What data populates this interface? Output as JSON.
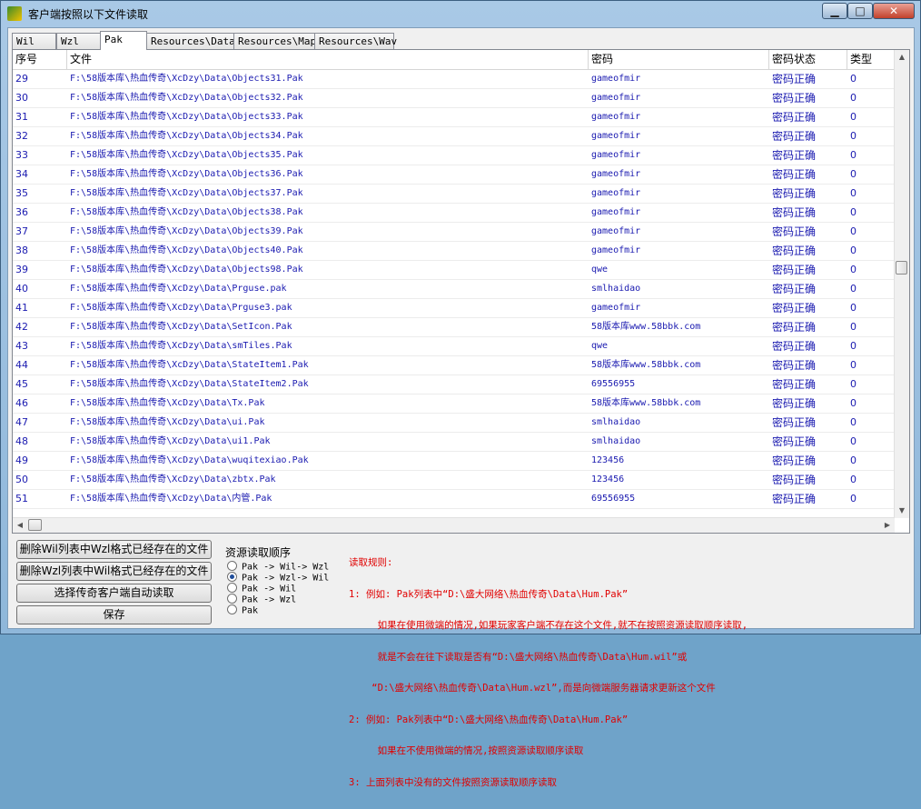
{
  "window": {
    "title": "客户端按照以下文件读取",
    "controls": {
      "minimize": "▁",
      "maximize": "□",
      "close": "✕"
    }
  },
  "tabs": [
    {
      "label": "Wil",
      "active": false
    },
    {
      "label": "Wzl",
      "active": false
    },
    {
      "label": "Pak",
      "active": true
    },
    {
      "label": "Resources\\Data",
      "active": false
    },
    {
      "label": "Resources\\Map",
      "active": false
    },
    {
      "label": "Resources\\Wav",
      "active": false
    }
  ],
  "table": {
    "columns": [
      "序号",
      "文件",
      "密码",
      "密码状态",
      "类型"
    ],
    "rows": [
      {
        "idx": "29",
        "file": "F:\\58版本库\\热血传奇\\XcDzy\\Data\\Objects31.Pak",
        "password": "gameofmir",
        "status": "密码正确",
        "type": "0"
      },
      {
        "idx": "30",
        "file": "F:\\58版本库\\热血传奇\\XcDzy\\Data\\Objects32.Pak",
        "password": "gameofmir",
        "status": "密码正确",
        "type": "0"
      },
      {
        "idx": "31",
        "file": "F:\\58版本库\\热血传奇\\XcDzy\\Data\\Objects33.Pak",
        "password": "gameofmir",
        "status": "密码正确",
        "type": "0"
      },
      {
        "idx": "32",
        "file": "F:\\58版本库\\热血传奇\\XcDzy\\Data\\Objects34.Pak",
        "password": "gameofmir",
        "status": "密码正确",
        "type": "0"
      },
      {
        "idx": "33",
        "file": "F:\\58版本库\\热血传奇\\XcDzy\\Data\\Objects35.Pak",
        "password": "gameofmir",
        "status": "密码正确",
        "type": "0"
      },
      {
        "idx": "34",
        "file": "F:\\58版本库\\热血传奇\\XcDzy\\Data\\Objects36.Pak",
        "password": "gameofmir",
        "status": "密码正确",
        "type": "0"
      },
      {
        "idx": "35",
        "file": "F:\\58版本库\\热血传奇\\XcDzy\\Data\\Objects37.Pak",
        "password": "gameofmir",
        "status": "密码正确",
        "type": "0"
      },
      {
        "idx": "36",
        "file": "F:\\58版本库\\热血传奇\\XcDzy\\Data\\Objects38.Pak",
        "password": "gameofmir",
        "status": "密码正确",
        "type": "0"
      },
      {
        "idx": "37",
        "file": "F:\\58版本库\\热血传奇\\XcDzy\\Data\\Objects39.Pak",
        "password": "gameofmir",
        "status": "密码正确",
        "type": "0"
      },
      {
        "idx": "38",
        "file": "F:\\58版本库\\热血传奇\\XcDzy\\Data\\Objects40.Pak",
        "password": "gameofmir",
        "status": "密码正确",
        "type": "0"
      },
      {
        "idx": "39",
        "file": "F:\\58版本库\\热血传奇\\XcDzy\\Data\\Objects98.Pak",
        "password": "qwe",
        "status": "密码正确",
        "type": "0"
      },
      {
        "idx": "40",
        "file": "F:\\58版本库\\热血传奇\\XcDzy\\Data\\Prguse.pak",
        "password": "smlhaidao",
        "status": "密码正确",
        "type": "0"
      },
      {
        "idx": "41",
        "file": "F:\\58版本库\\热血传奇\\XcDzy\\Data\\Prguse3.pak",
        "password": "gameofmir",
        "status": "密码正确",
        "type": "0"
      },
      {
        "idx": "42",
        "file": "F:\\58版本库\\热血传奇\\XcDzy\\Data\\SetIcon.Pak",
        "password": "58版本库www.58bbk.com",
        "status": "密码正确",
        "type": "0"
      },
      {
        "idx": "43",
        "file": "F:\\58版本库\\热血传奇\\XcDzy\\Data\\smTiles.Pak",
        "password": "qwe",
        "status": "密码正确",
        "type": "0"
      },
      {
        "idx": "44",
        "file": "F:\\58版本库\\热血传奇\\XcDzy\\Data\\StateItem1.Pak",
        "password": "58版本库www.58bbk.com",
        "status": "密码正确",
        "type": "0"
      },
      {
        "idx": "45",
        "file": "F:\\58版本库\\热血传奇\\XcDzy\\Data\\StateItem2.Pak",
        "password": "69556955",
        "status": "密码正确",
        "type": "0"
      },
      {
        "idx": "46",
        "file": "F:\\58版本库\\热血传奇\\XcDzy\\Data\\Tx.Pak",
        "password": "58版本库www.58bbk.com",
        "status": "密码正确",
        "type": "0"
      },
      {
        "idx": "47",
        "file": "F:\\58版本库\\热血传奇\\XcDzy\\Data\\ui.Pak",
        "password": "smlhaidao",
        "status": "密码正确",
        "type": "0"
      },
      {
        "idx": "48",
        "file": "F:\\58版本库\\热血传奇\\XcDzy\\Data\\ui1.Pak",
        "password": "smlhaidao",
        "status": "密码正确",
        "type": "0"
      },
      {
        "idx": "49",
        "file": "F:\\58版本库\\热血传奇\\XcDzy\\Data\\wuqitexiao.Pak",
        "password": "123456",
        "status": "密码正确",
        "type": "0"
      },
      {
        "idx": "50",
        "file": "F:\\58版本库\\热血传奇\\XcDzy\\Data\\zbtx.Pak",
        "password": "123456",
        "status": "密码正确",
        "type": "0"
      },
      {
        "idx": "51",
        "file": "F:\\58版本库\\热血传奇\\XcDzy\\Data\\内管.Pak",
        "password": "69556955",
        "status": "密码正确",
        "type": "0"
      }
    ]
  },
  "buttons": {
    "delete_wil": "删除Wil列表中Wzl格式已经存在的文件",
    "delete_wzl": "删除Wzl列表中Wil格式已经存在的文件",
    "select_client": "选择传奇客户端自动读取",
    "save": "保存"
  },
  "order": {
    "title": "资源读取顺序",
    "options": [
      {
        "label": "Pak -> Wil-> Wzl",
        "selected": false
      },
      {
        "label": "Pak -> Wzl-> Wil",
        "selected": true
      },
      {
        "label": "Pak -> Wil",
        "selected": false
      },
      {
        "label": "Pak -> Wzl",
        "selected": false
      },
      {
        "label": "Pak",
        "selected": false
      }
    ]
  },
  "rules": {
    "lines": [
      "读取规则:",
      "1: 例如: Pak列表中“D:\\盛大网络\\热血传奇\\Data\\Hum.Pak”",
      "     如果在使用微端的情况,如果玩家客户端不存在这个文件,就不在按照资源读取顺序读取,",
      "     就是不会在往下读取是否有“D:\\盛大网络\\热血传奇\\Data\\Hum.wil”或",
      "    “D:\\盛大网络\\热血传奇\\Data\\Hum.wzl”,而是向微端服务器请求更新这个文件",
      "2: 例如: Pak列表中“D:\\盛大网络\\热血传奇\\Data\\Hum.Pak”",
      "     如果在不使用微端的情况,按照资源读取顺序读取",
      "3: 上面列表中没有的文件按照资源读取顺序读取"
    ]
  }
}
